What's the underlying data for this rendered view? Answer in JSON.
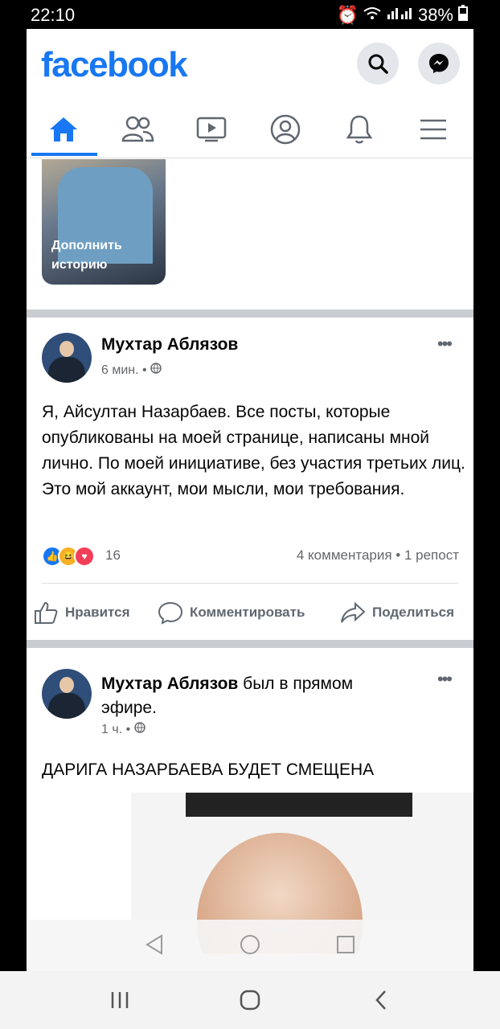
{
  "status": {
    "time": "22:10",
    "battery": "38%"
  },
  "header": {
    "logo": "facebook"
  },
  "nav": {
    "tabs": [
      "home-icon",
      "friends-icon",
      "watch-icon",
      "profile-icon",
      "bell-icon",
      "menu-icon"
    ],
    "active": "home"
  },
  "story": {
    "label_line1": "Дополнить",
    "label_line2": "историю"
  },
  "post1": {
    "author": "Мухтар Аблязов",
    "time": "6 мин. •",
    "text": "Я, Айсултан Назарбаев. Все посты, которые опубликованы на моей странице,  написаны мной лично. По моей инициативе,  без участия третьих лиц. Это мой аккаунт, мои мысли, мои требования.",
    "reaction_count": "16",
    "stats": "4 комментария • 1 репост",
    "actions": {
      "like": "Нравится",
      "comment": "Комментировать",
      "share": "Поделиться"
    }
  },
  "post2": {
    "author": "Мухтар Аблязов",
    "status_rest": " был в прямом",
    "status_line2": "эфире.",
    "time": "1 ч. •",
    "headline": "ДАРИГА НАЗАРБАЕВА БУДЕТ СМЕЩЕНА"
  },
  "colors": {
    "brand": "#1877f2",
    "separator": "#c9ccd1"
  }
}
